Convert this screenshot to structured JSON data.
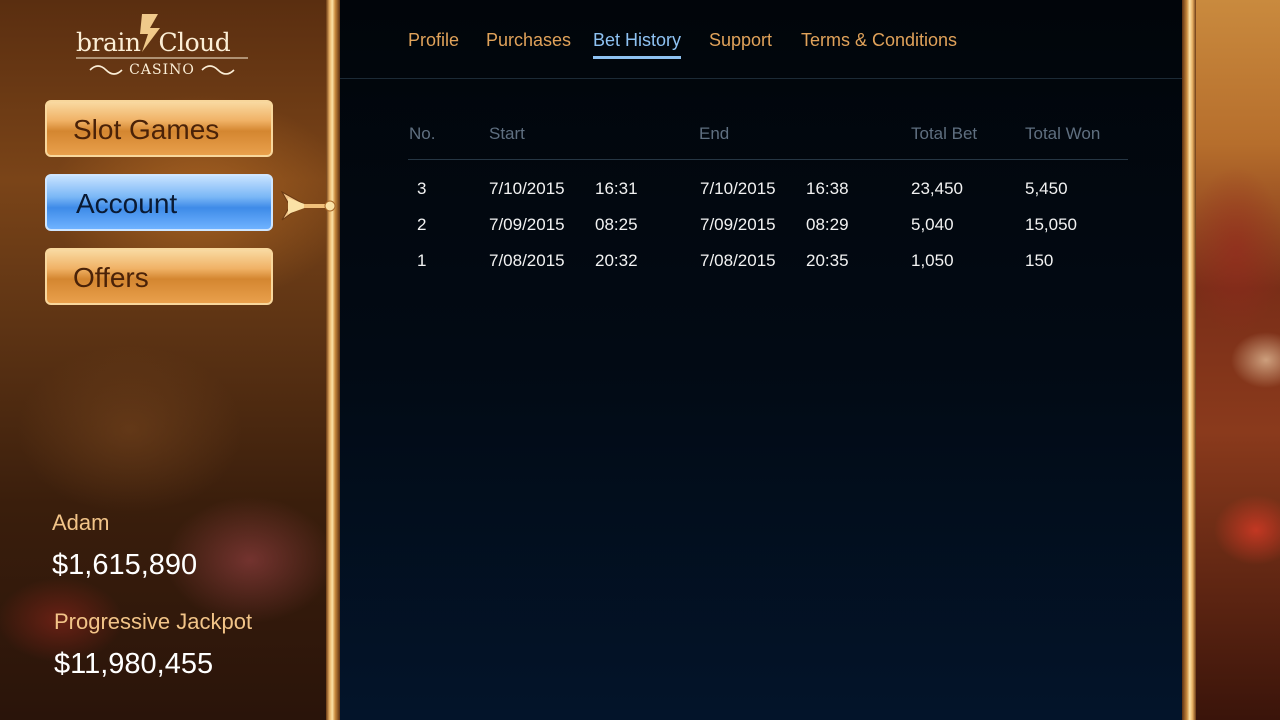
{
  "logo": {
    "brand_left": "brain",
    "brand_right": "Cloud",
    "subtitle": "CASINO"
  },
  "sidebar": {
    "items": [
      {
        "label": "Slot Games",
        "state": "normal"
      },
      {
        "label": "Account",
        "state": "selected"
      },
      {
        "label": "Offers",
        "state": "normal"
      }
    ],
    "selected_pointer_icon": "arrow-pointer-icon"
  },
  "user": {
    "name": "Adam",
    "balance": "$1,615,890"
  },
  "jackpot": {
    "label": "Progressive Jackpot",
    "value": "$11,980,455"
  },
  "tabs": [
    {
      "label": "Profile",
      "active": false
    },
    {
      "label": "Purchases",
      "active": false
    },
    {
      "label": "Bet History",
      "active": true
    },
    {
      "label": "Support",
      "active": false
    },
    {
      "label": "Terms & Conditions",
      "active": false
    }
  ],
  "table": {
    "headers": {
      "no": "No.",
      "start": "Start",
      "end": "End",
      "total_bet": "Total Bet",
      "total_won": "Total Won"
    },
    "rows": [
      {
        "no": "3",
        "start_date": "7/10/2015",
        "start_time": "16:31",
        "end_date": "7/10/2015",
        "end_time": "16:38",
        "total_bet": "23,450",
        "total_won": "5,450"
      },
      {
        "no": "2",
        "start_date": "7/09/2015",
        "start_time": "08:25",
        "end_date": "7/09/2015",
        "end_time": "08:29",
        "total_bet": "5,040",
        "total_won": "15,050"
      },
      {
        "no": "1",
        "start_date": "7/08/2015",
        "start_time": "20:32",
        "end_date": "7/08/2015",
        "end_time": "20:35",
        "total_bet": "1,050",
        "total_won": "150"
      }
    ]
  },
  "colors": {
    "tab_text": "#e0a25a",
    "tab_active": "#8ec2f2",
    "gold_accent": "#f2c488",
    "selected_button": "#4a96ee"
  }
}
